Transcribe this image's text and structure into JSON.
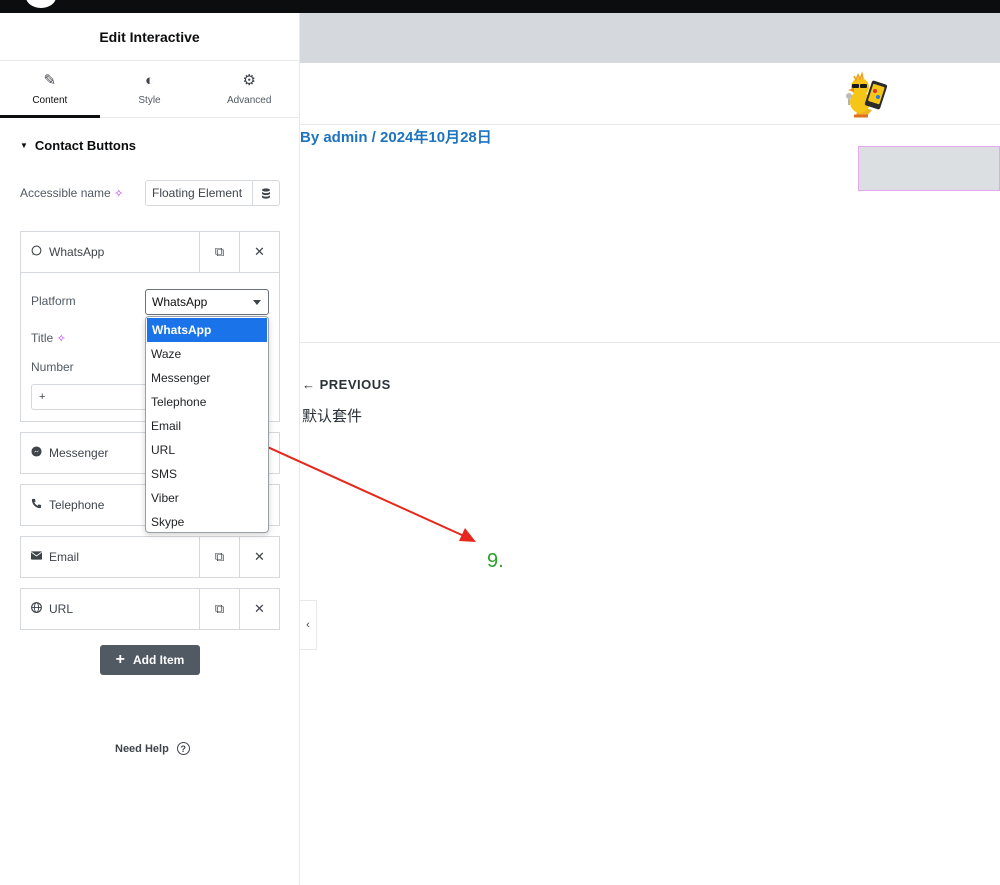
{
  "panel": {
    "title": "Edit Interactive",
    "tabs": [
      {
        "label": "Content",
        "icon": "pencil-icon"
      },
      {
        "label": "Style",
        "icon": "half-circle-icon"
      },
      {
        "label": "Advanced",
        "icon": "gear-icon"
      }
    ]
  },
  "section": {
    "title": "Contact Buttons"
  },
  "accessible": {
    "label": "Accessible name",
    "value": "Floating Element"
  },
  "items": [
    {
      "label": "WhatsApp",
      "icon": "whatsapp-icon"
    },
    {
      "label": "Messenger",
      "icon": "messenger-icon"
    },
    {
      "label": "Telephone",
      "icon": "phone-icon"
    },
    {
      "label": "Email",
      "icon": "envelope-icon"
    },
    {
      "label": "URL",
      "icon": "globe-icon"
    }
  ],
  "fields": {
    "platform_label": "Platform",
    "platform_value": "WhatsApp",
    "title_label": "Title",
    "number_label": "Number",
    "number_value": "+"
  },
  "dropdown": {
    "selected": "WhatsApp",
    "options": [
      "WhatsApp",
      "Waze",
      "Messenger",
      "Telephone",
      "Email",
      "URL",
      "SMS",
      "Viber",
      "Skype"
    ]
  },
  "add_item": "Add Item",
  "need_help": "Need Help",
  "preview": {
    "byline": "By admin / 2024年10月28日",
    "previous_label": "← PREVIOUS",
    "previous_title": "默认套件",
    "annotation": "9.",
    "annotation_color": "#2aa02a",
    "arrow_color": "#e8271c"
  }
}
